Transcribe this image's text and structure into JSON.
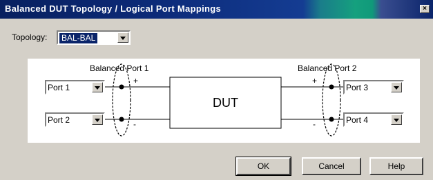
{
  "window": {
    "title": "Balanced DUT Topology / Logical Port Mappings",
    "close_glyph": "×"
  },
  "topology": {
    "label": "Topology:",
    "value": "BAL-BAL"
  },
  "diagram": {
    "port1_title": "Balanced Port 1",
    "port2_title": "Balanced Port 2",
    "dut_label": "DUT",
    "plus": "+",
    "minus": "-",
    "port_selects": [
      "Port 1",
      "Port 2",
      "Port 3",
      "Port 4"
    ]
  },
  "buttons": {
    "ok": "OK",
    "cancel": "Cancel",
    "help": "Help"
  }
}
